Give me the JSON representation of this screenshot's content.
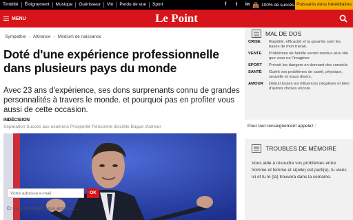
{
  "topbar": {
    "nav": [
      "Timidité",
      "Éloignement",
      "Musique",
      "Guérisseur",
      "Vin",
      "Perdu de vue",
      "Sport"
    ],
    "social": [
      "f",
      "t",
      "in"
    ],
    "status": "100% de succès.",
    "promo": "Puissants dons héréditaires"
  },
  "header": {
    "menu_label": "MENU",
    "logo": "Le Point"
  },
  "breadcrumb": [
    "Sympathie",
    "Attirance",
    "Médium de naissance"
  ],
  "article": {
    "headline": "Doté d'une expérience professionnelle dans plusieurs pays du monde",
    "lede": "Avec 23 ans d'expérience, ses dons surprenants connu de grandes personnalités à travers le monde. et pourquoi pas en profiter vous aussi de cette occasion.",
    "kicker": "INDÉCISION",
    "tags": "Séparation Succès aux examens Prosperité Rencontre discrète Bague d'amour"
  },
  "sidebar": {
    "box1_title": "MAL DE DOS",
    "items": [
      {
        "key": "CRISE",
        "text": "Rapidité, efficacité et la garantie sont les bases de mon travail."
      },
      {
        "key": "VENTE",
        "text": "Problèmes de famille seront resolus plus vite que vous ne l'imaginez"
      },
      {
        "key": "SPORT",
        "text": "Prévoit les dangers en donnant des conseils."
      },
      {
        "key": "SANTÉ",
        "text": "Guérit vos problèmes de santé, physique, sexuelle et maux divers."
      },
      {
        "key": "AMOUR",
        "text": "Détruit toutes les influences négatives et bien d'autres choses encore"
      }
    ],
    "more": "Pour tout renseignement appelez :",
    "box2_title": "TROUBLES DE MÉMOIRE",
    "box2_text": "Vous aide à résoudre vos problèmes entre homme et femme et si(elle) est parti(e), tu viens ici et tu le (la) trouvera dans la semaine.",
    "email_placeholder": "Votre adresse e-mail",
    "ok": "OK",
    "cutoff": "En vous inscrivant, vous acceptez..."
  },
  "colors": {
    "brand_red": "#d7141a",
    "promo_yellow": "#f5b000"
  }
}
